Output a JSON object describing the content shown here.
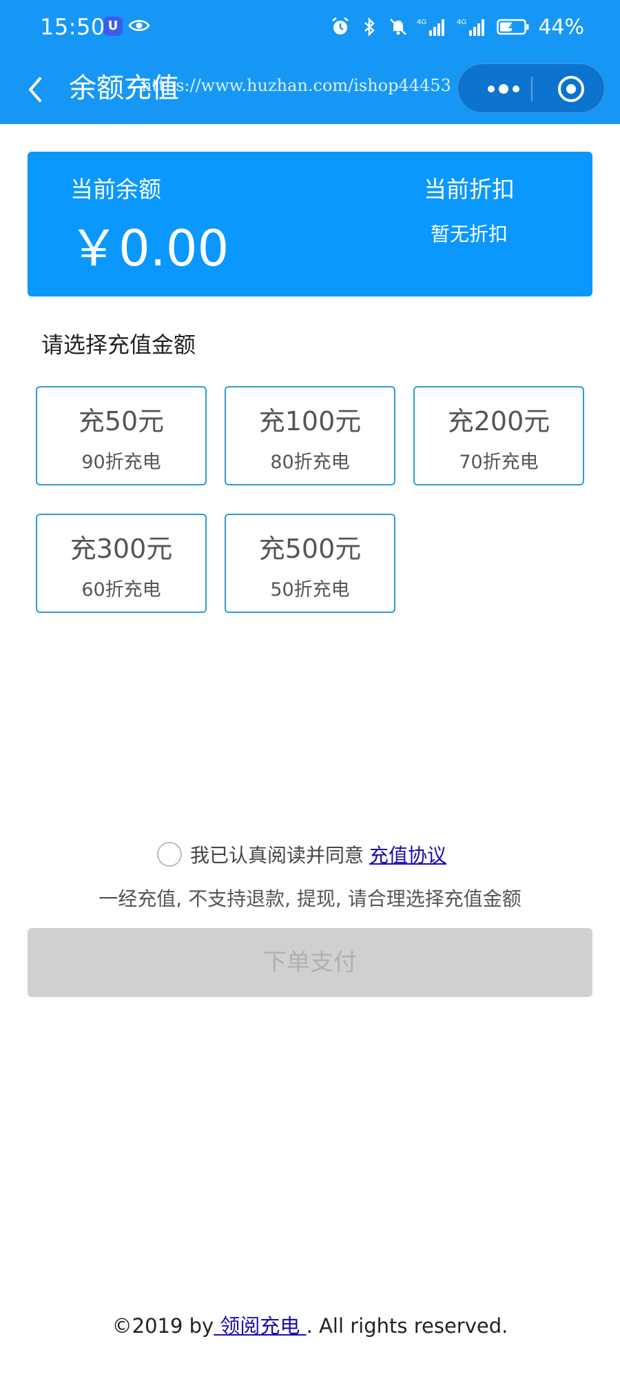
{
  "status_bar": {
    "time": "15:50",
    "app_badge": "U",
    "battery_percent": "44%",
    "icons": [
      "eye-icon",
      "alarm-icon",
      "bluetooth-icon",
      "mute-icon",
      "signal-4g-icon",
      "signal-4g-icon",
      "battery-icon"
    ]
  },
  "nav": {
    "title": "余额充值",
    "watermark": "https://www.huzhan.com/ishop44453",
    "more_label": "•••"
  },
  "balance": {
    "label": "当前余额",
    "amount": "￥0.00",
    "discount_label": "当前折扣",
    "discount_value": "暂无折扣"
  },
  "section": {
    "title": "请选择充值金额"
  },
  "options": [
    {
      "title": "充50元",
      "subtitle": "90折充电"
    },
    {
      "title": "充100元",
      "subtitle": "80折充电"
    },
    {
      "title": "充200元",
      "subtitle": "70折充电"
    },
    {
      "title": "充300元",
      "subtitle": "60折充电"
    },
    {
      "title": "充500元",
      "subtitle": "50折充电"
    }
  ],
  "agreement": {
    "text": "我已认真阅读并同意",
    "link": "充值协议",
    "notice": "一经充值, 不支持退款, 提现, 请合理选择充值金额"
  },
  "pay_button": {
    "label": "下单支付"
  },
  "footer": {
    "prefix": "©2019 by",
    "brand": " 领阅充电 ",
    "suffix": ". All rights reserved."
  },
  "colors": {
    "primary": "#1797f5",
    "card": "#0a98ff",
    "option_border": "#2c9ad6",
    "button_disabled": "#d0d0d0",
    "link": "#1a0dab"
  }
}
